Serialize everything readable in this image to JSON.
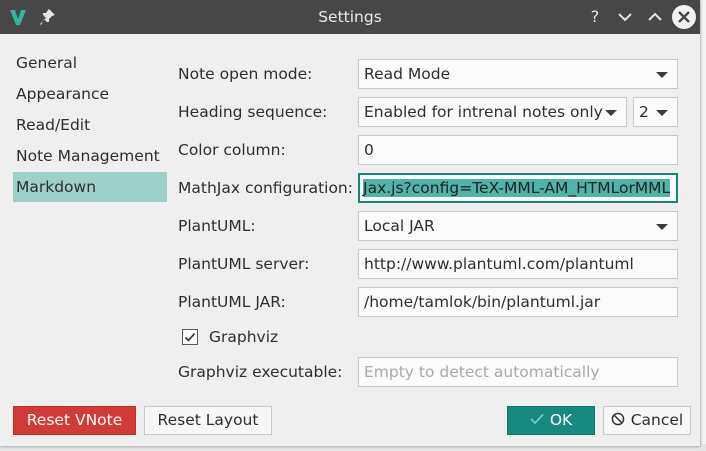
{
  "window": {
    "title": "Settings"
  },
  "titlebar": {
    "help": "?",
    "minimize": "∨",
    "maximize": "∧",
    "close": "✕"
  },
  "colors": {
    "accent": "#168a7e",
    "selection": "#9cd0c9",
    "danger": "#d13b36",
    "titlebar": "#474747"
  },
  "sidebar": {
    "items": [
      {
        "label": "General"
      },
      {
        "label": "Appearance"
      },
      {
        "label": "Read/Edit"
      },
      {
        "label": "Note Management"
      },
      {
        "label": "Markdown",
        "active": true
      }
    ]
  },
  "form": {
    "note_open_mode": {
      "label": "Note open mode:",
      "value": "Read Mode"
    },
    "heading_sequence": {
      "label": "Heading sequence:",
      "value": "Enabled for intrenal notes only",
      "level": "2"
    },
    "color_column": {
      "label": "Color column:",
      "value": "0"
    },
    "mathjax": {
      "label": "MathJax configuration:",
      "value": "Jax.js?config=TeX-MML-AM_HTMLorMML"
    },
    "plantuml": {
      "label": "PlantUML:",
      "value": "Local JAR"
    },
    "plantuml_server": {
      "label": "PlantUML server:",
      "value": "http://www.plantuml.com/plantuml"
    },
    "plantuml_jar": {
      "label": "PlantUML JAR:",
      "value": "/home/tamlok/bin/plantuml.jar"
    },
    "graphviz": {
      "label": "Graphviz",
      "checked": true
    },
    "graphviz_exec": {
      "label": "Graphviz executable:",
      "placeholder": "Empty to detect automatically"
    }
  },
  "buttons": {
    "reset_vnote": "Reset VNote",
    "reset_layout": "Reset Layout",
    "ok": "OK",
    "cancel": "Cancel"
  }
}
